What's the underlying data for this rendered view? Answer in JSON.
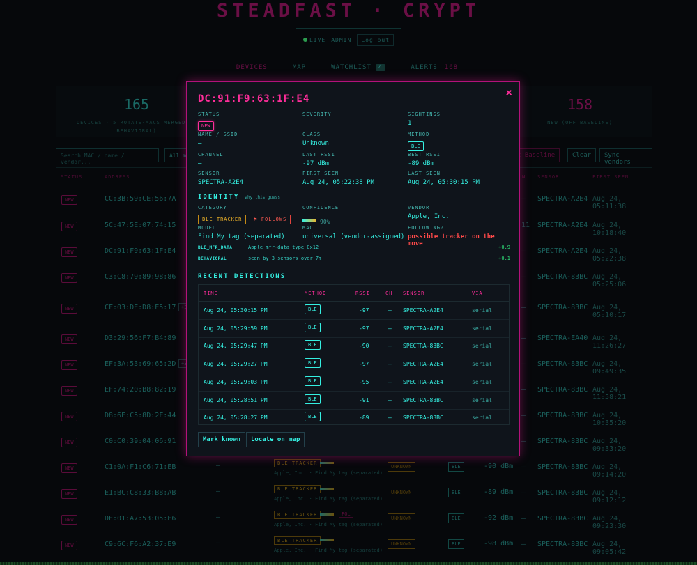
{
  "app": {
    "brand": "STEADFAST · CRYPT",
    "live_label": "LIVE",
    "user_label": "ADMIN",
    "logout_label": "Log out"
  },
  "nav": {
    "tabs": [
      {
        "label": "DEVICES",
        "active": true
      },
      {
        "label": "MAP"
      },
      {
        "label": "WATCHLIST",
        "count": "4"
      },
      {
        "label": "ALERTS",
        "count": "168"
      }
    ]
  },
  "stats": {
    "devices_count": "165",
    "devices_label_1": "DEVICES · 5 ROTATE-MACS MERGED IN",
    "devices_label_2": "BEHAVIORAL)",
    "new_count": "158",
    "new_label": "NEW (OFF BASELINE)"
  },
  "filters": {
    "search_placeholder": "Search MAC / name / vendor...",
    "select_value": "All m",
    "baseline_label": "t Baseline",
    "clear_label": "Clear",
    "sync_label": "Sync vendors"
  },
  "table": {
    "headers": {
      "status": "STATUS",
      "address": "ADDRESS",
      "method": "N",
      "sensor": "SENSOR",
      "first_seen": "FIRST SEEN"
    },
    "rows": [
      {
        "status": "NEW",
        "address": "CC:3B:59:CE:56:7A",
        "dash": "—",
        "sensor": "SPECTRA-A2E4",
        "seen": "Aug 24, 05:11:38"
      },
      {
        "status": "NEW",
        "address": "5C:47:5E:07:74:15",
        "dash": "11",
        "sensor": "SPECTRA-A2E4",
        "seen": "Aug 24, 10:18:40"
      },
      {
        "status": "NEW",
        "address": "DC:91:F9:63:1F:E4",
        "dash": "—",
        "sensor": "SPECTRA-A2E4",
        "seen": "Aug 24, 05:22:38"
      },
      {
        "status": "NEW",
        "address": "C3:C8:79:89:98:86",
        "dash": "—",
        "sensor": "SPECTRA-83BC",
        "seen": "Aug 24, 05:25:06"
      },
      {
        "status": "NEW",
        "address": "CF:03:DE:D8:E5:17",
        "plus": "+3",
        "dash": "—",
        "sensor": "SPECTRA-83BC",
        "seen": "Aug 24, 05:10:17"
      },
      {
        "status": "NEW",
        "address": "D3:29:56:F7:B4:89",
        "dash": "—",
        "sensor": "SPECTRA-EA40",
        "seen": "Aug 24, 11:26:27"
      },
      {
        "status": "NEW",
        "address": "EF:3A:53:69:65:2D",
        "plus": "+3",
        "dash": "—",
        "sensor": "SPECTRA-83BC",
        "seen": "Aug 24, 09:49:35"
      },
      {
        "status": "NEW",
        "address": "EF:74:20:B8:82:19",
        "dash": "—",
        "sensor": "SPECTRA-83BC",
        "seen": "Aug 24, 11:58:21"
      },
      {
        "status": "NEW",
        "address": "D8:6E:C5:8D:2F:44",
        "dash": "—",
        "sensor": "SPECTRA-83BC",
        "seen": "Aug 24, 10:35:20"
      },
      {
        "status": "NEW",
        "address": "C0:C0:39:04:06:91",
        "dash": "—",
        "sensor": "SPECTRA-83BC",
        "seen": "Aug 24, 09:33:20"
      },
      {
        "status": "NEW",
        "address": "C1:0A:F1:C6:71:EB",
        "name": "—",
        "cat": "BLE TRACKER",
        "vendor": "Apple, Inc. · Find My tag (separated)",
        "unknown": "UNKNOWN",
        "method": "BLE",
        "rssi": "-90 dBm",
        "dash": "—",
        "sensor": "SPECTRA-83BC",
        "seen": "Aug 24, 09:14:20"
      },
      {
        "status": "NEW",
        "address": "E1:BC:C8:33:B8:AB",
        "name": "—",
        "cat": "BLE TRACKER",
        "vendor": "Apple, Inc. · Find My tag (separated)",
        "unknown": "UNKNOWN",
        "method": "BLE",
        "rssi": "-89 dBm",
        "dash": "—",
        "sensor": "SPECTRA-83BC",
        "seen": "Aug 24, 09:12:12"
      },
      {
        "status": "NEW",
        "address": "DE:01:A7:53:05:E6",
        "name": "—",
        "cat": "BLE TRACKER",
        "tag": "FOL",
        "vendor": "Apple, Inc. · Find My tag (separated)",
        "unknown": "UNKNOWN",
        "method": "BLE",
        "rssi": "-92 dBm",
        "dash": "—",
        "sensor": "SPECTRA-83BC",
        "seen": "Aug 24, 09:23:30"
      },
      {
        "status": "NEW",
        "address": "C9:6C:F6:A2:37:E9",
        "name": "—",
        "cat": "BLE TRACKER",
        "vendor": "Apple, Inc. · Find My tag (separated)",
        "unknown": "UNKNOWN",
        "method": "BLE",
        "rssi": "-98 dBm",
        "dash": "—",
        "sensor": "SPECTRA-83BC",
        "seen": "Aug 24, 09:05:42"
      }
    ]
  },
  "modal": {
    "title": "DC:91:F9:63:1F:E4",
    "close_icon": "×",
    "fields": {
      "status_label": "STATUS",
      "status_value": "NEW",
      "severity_label": "SEVERITY",
      "severity_value": "—",
      "sightings_label": "SIGHTINGS",
      "sightings_value": "1",
      "name_label": "NAME / SSID",
      "name_value": "—",
      "class_label": "CLASS",
      "class_value": "Unknown",
      "method_label": "METHOD",
      "method_value": "BLE",
      "channel_label": "CHANNEL",
      "channel_value": "—",
      "last_rssi_label": "LAST RSSI",
      "last_rssi_value": "-97 dBm",
      "best_rssi_label": "BEST RSSI",
      "best_rssi_value": "-89 dBm",
      "sensor_label": "SENSOR",
      "sensor_value": "SPECTRA-A2E4",
      "first_seen_label": "FIRST SEEN",
      "first_seen_value": "Aug 24, 05:22:38 PM",
      "last_seen_label": "LAST SEEN",
      "last_seen_value": "Aug 24, 05:30:15 PM"
    },
    "identity": {
      "heading": "IDENTITY",
      "why_link": "why this guess",
      "category_label": "CATEGORY",
      "category_value": "BLE TRACKER",
      "follows_badge": "⚑ FOLLOWS",
      "confidence_label": "CONFIDENCE",
      "confidence_value": "90%",
      "confidence": 0.9,
      "vendor_label": "VENDOR",
      "vendor_value": "Apple, Inc.",
      "model_label": "MODEL",
      "model_value": "Find My tag (separated)",
      "mac_label": "MAC",
      "mac_value": "universal (vendor-assigned)",
      "following_label": "FOLLOWING?",
      "following_value": "possible tracker on the move",
      "evidence": [
        {
          "key": "BLE_MFR_DATA",
          "desc": "Apple mfr-data type 0x12",
          "score": "+0.9"
        },
        {
          "key": "BEHAVIORAL",
          "desc": "seen by 3 sensors over 7m",
          "score": "+0.1"
        }
      ]
    },
    "detections": {
      "heading": "RECENT DETECTIONS",
      "headers": {
        "time": "TIME",
        "method": "METHOD",
        "rssi": "RSSI",
        "ch": "CH",
        "sensor": "SENSOR",
        "via": "VIA"
      },
      "rows": [
        {
          "time": "Aug 24, 05:30:15 PM",
          "method": "BLE",
          "rssi": "-97",
          "ch": "—",
          "sensor": "SPECTRA-A2E4",
          "via": "serial"
        },
        {
          "time": "Aug 24, 05:29:59 PM",
          "method": "BLE",
          "rssi": "-97",
          "ch": "—",
          "sensor": "SPECTRA-A2E4",
          "via": "serial"
        },
        {
          "time": "Aug 24, 05:29:47 PM",
          "method": "BLE",
          "rssi": "-90",
          "ch": "—",
          "sensor": "SPECTRA-83BC",
          "via": "serial"
        },
        {
          "time": "Aug 24, 05:29:27 PM",
          "method": "BLE",
          "rssi": "-97",
          "ch": "—",
          "sensor": "SPECTRA-A2E4",
          "via": "serial"
        },
        {
          "time": "Aug 24, 05:29:03 PM",
          "method": "BLE",
          "rssi": "-95",
          "ch": "—",
          "sensor": "SPECTRA-A2E4",
          "via": "serial"
        },
        {
          "time": "Aug 24, 05:28:51 PM",
          "method": "BLE",
          "rssi": "-91",
          "ch": "—",
          "sensor": "SPECTRA-83BC",
          "via": "serial"
        },
        {
          "time": "Aug 24, 05:28:27 PM",
          "method": "BLE",
          "rssi": "-89",
          "ch": "—",
          "sensor": "SPECTRA-83BC",
          "via": "serial"
        }
      ]
    },
    "actions": {
      "mark_known": "Mark known",
      "locate": "Locate on map"
    }
  }
}
